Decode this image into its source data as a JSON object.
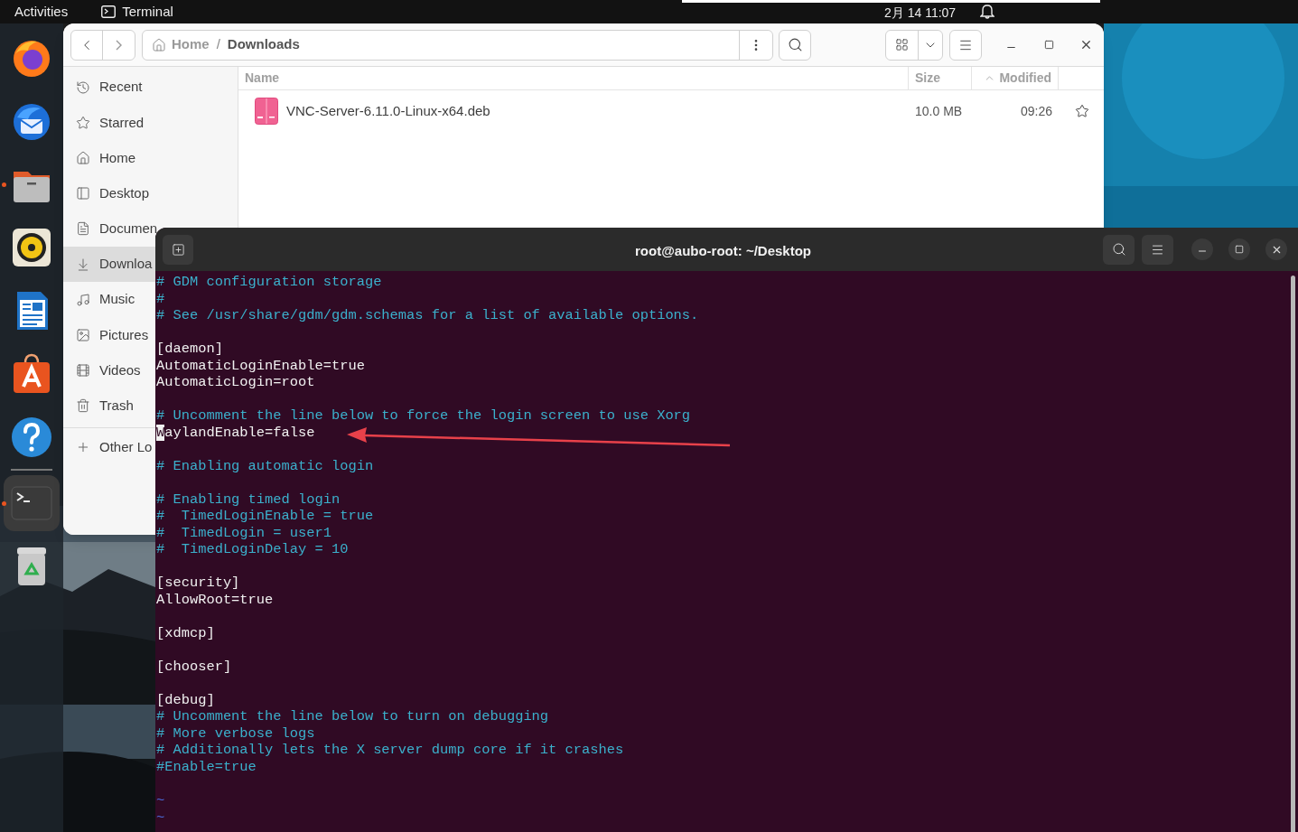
{
  "top_bar": {
    "activities": "Activities",
    "app": "Terminal",
    "clock": "2月 14 11:07"
  },
  "dock": {
    "favorites": [
      {
        "kind": "firefox",
        "running": false,
        "active": false
      },
      {
        "kind": "mail",
        "running": false,
        "active": false
      },
      {
        "kind": "files",
        "running": true,
        "active": false
      },
      {
        "kind": "music",
        "running": false,
        "active": false
      },
      {
        "kind": "writer",
        "running": false,
        "active": false
      },
      {
        "kind": "store",
        "running": false,
        "active": false
      },
      {
        "kind": "help",
        "running": false,
        "active": false
      }
    ],
    "others": [
      {
        "kind": "terminal",
        "running": true,
        "active": true
      },
      {
        "kind": "trash",
        "running": false,
        "active": false
      }
    ]
  },
  "files_window": {
    "path": [
      {
        "label": "Home",
        "kind": "home"
      },
      {
        "label": "/",
        "kind": "separator"
      },
      {
        "label": "Downloads",
        "kind": "current"
      }
    ],
    "sidebar": {
      "items": [
        {
          "label": "Recent",
          "kind": "recent",
          "selected": false
        },
        {
          "label": "Starred",
          "kind": "starred",
          "selected": false
        },
        {
          "label": "Home",
          "kind": "home",
          "selected": false
        },
        {
          "label": "Desktop",
          "kind": "desktop",
          "selected": false
        },
        {
          "label": "Documen",
          "kind": "documents",
          "selected": false
        },
        {
          "label": "Downloa",
          "kind": "downloads",
          "selected": true
        },
        {
          "label": "Music",
          "kind": "music",
          "selected": false
        },
        {
          "label": "Pictures",
          "kind": "pictures",
          "selected": false
        },
        {
          "label": "Videos",
          "kind": "videos",
          "selected": false
        },
        {
          "label": "Trash",
          "kind": "trash",
          "selected": false
        }
      ],
      "other": {
        "label": "Other Lo",
        "kind": "other"
      }
    },
    "columns": [
      {
        "label": "Name",
        "sorted": false
      },
      {
        "label": "Size",
        "sorted": false
      },
      {
        "label": "Modified",
        "sorted": true
      }
    ],
    "rows": [
      {
        "name": "VNC-Server-6.11.0-Linux-x64.deb",
        "size": "10.0 MB",
        "modified": "09:26",
        "starred": false
      }
    ]
  },
  "terminal": {
    "title": "root@aubo-root: ~/Desktop",
    "lines": [
      {
        "kind": "comment",
        "text": "# GDM configuration storage"
      },
      {
        "kind": "comment",
        "text": "#"
      },
      {
        "kind": "comment",
        "text": "# See /usr/share/gdm/gdm.schemas for a list of available options."
      },
      {
        "kind": "blank"
      },
      {
        "kind": "text",
        "text": "[daemon]"
      },
      {
        "kind": "text",
        "text": "AutomaticLoginEnable=true"
      },
      {
        "kind": "text",
        "text": "AutomaticLogin=root"
      },
      {
        "kind": "blank"
      },
      {
        "kind": "comment",
        "text": "# Uncomment the line below to force the login screen to use Xorg"
      },
      {
        "kind": "text",
        "text": "WaylandEnable=false",
        "cursor": true
      },
      {
        "kind": "blank"
      },
      {
        "kind": "comment",
        "text": "# Enabling automatic login"
      },
      {
        "kind": "blank"
      },
      {
        "kind": "comment",
        "text": "# Enabling timed login"
      },
      {
        "kind": "comment",
        "text": "#  TimedLoginEnable = true"
      },
      {
        "kind": "comment",
        "text": "#  TimedLogin = user1"
      },
      {
        "kind": "comment",
        "text": "#  TimedLoginDelay = 10"
      },
      {
        "kind": "blank"
      },
      {
        "kind": "text",
        "text": "[security]"
      },
      {
        "kind": "text",
        "text": "AllowRoot=true"
      },
      {
        "kind": "blank"
      },
      {
        "kind": "text",
        "text": "[xdmcp]"
      },
      {
        "kind": "blank"
      },
      {
        "kind": "text",
        "text": "[chooser]"
      },
      {
        "kind": "blank"
      },
      {
        "kind": "text",
        "text": "[debug]"
      },
      {
        "kind": "comment",
        "text": "# Uncomment the line below to turn on debugging"
      },
      {
        "kind": "comment",
        "text": "# More verbose logs"
      },
      {
        "kind": "comment",
        "text": "# Additionally lets the X server dump core if it crashes"
      },
      {
        "kind": "comment",
        "text": "#Enable=true"
      },
      {
        "kind": "blank"
      },
      {
        "kind": "tilde",
        "text": "~"
      },
      {
        "kind": "tilde",
        "text": "~"
      }
    ]
  }
}
